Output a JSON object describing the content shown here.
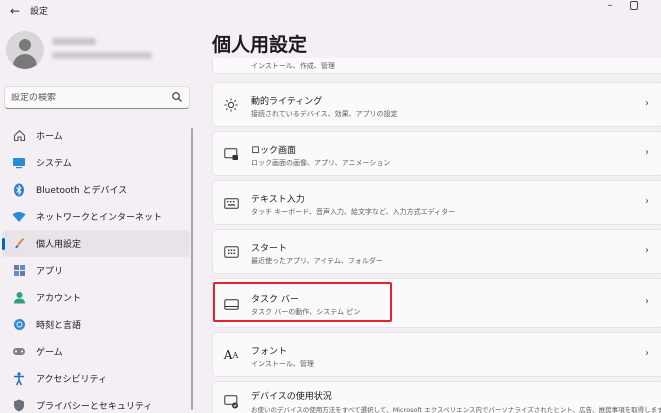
{
  "window": {
    "title": "設定",
    "back": "←",
    "minimize": "–"
  },
  "sidebar": {
    "search_placeholder": "設定の検索",
    "items": [
      {
        "label": "ホーム",
        "icon": "home-icon"
      },
      {
        "label": "システム",
        "icon": "monitor-icon"
      },
      {
        "label": "Bluetooth とデバイス",
        "icon": "bluetooth-icon"
      },
      {
        "label": "ネットワークとインターネット",
        "icon": "wifi-icon"
      },
      {
        "label": "個人用設定",
        "icon": "brush-icon",
        "active": true
      },
      {
        "label": "アプリ",
        "icon": "apps-icon"
      },
      {
        "label": "アカウント",
        "icon": "person-icon"
      },
      {
        "label": "時刻と言語",
        "icon": "globe-icon"
      },
      {
        "label": "ゲーム",
        "icon": "gamepad-icon"
      },
      {
        "label": "アクセシビリティ",
        "icon": "accessibility-icon"
      },
      {
        "label": "プライバシーとセキュリティ",
        "icon": "shield-icon"
      }
    ]
  },
  "main": {
    "title": "個人用設定",
    "cards": [
      {
        "title": "",
        "subtitle": "インストール、作成、管理"
      },
      {
        "title": "動的ライティング",
        "subtitle": "接続されているデバイス、効果、アプリの設定"
      },
      {
        "title": "ロック画面",
        "subtitle": "ロック画面の画像、アプリ、アニメーション"
      },
      {
        "title": "テキスト入力",
        "subtitle": "タッチ キーボード、音声入力、絵文字など、入力方式エディター"
      },
      {
        "title": "スタート",
        "subtitle": "最近使ったアプリ、アイテム、フォルダー"
      },
      {
        "title": "タスク バー",
        "subtitle": "タスク バーの動作、システム ピン"
      },
      {
        "title": "フォント",
        "subtitle": "インストール、管理"
      },
      {
        "title": "デバイスの使用状況",
        "subtitle": "お使いのデバイスの使用方法をすべて選択して、Microsoft エクスペリエンス内でパーソナライズされたヒント、広告、推奨事項を取得します。"
      }
    ],
    "chevron": "›"
  },
  "colors": {
    "accent": "#0067c0",
    "highlight": "#e0262c"
  }
}
